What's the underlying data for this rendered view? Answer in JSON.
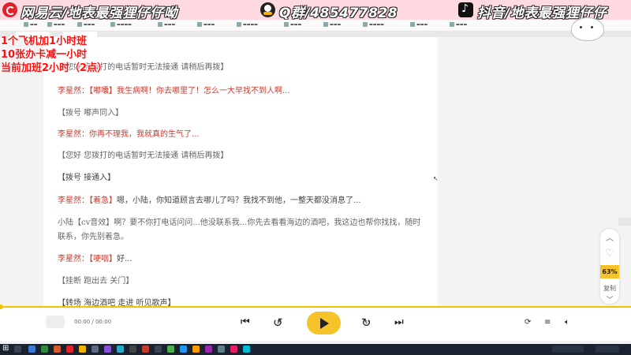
{
  "banner": {
    "netease_text": "网易云/地表最强狸仔仔呦",
    "qq_text": "Q群/485477828",
    "douyin_text": "抖音/地表最强狸仔仔"
  },
  "overlay": {
    "line1": "1个飞机加1小时班",
    "line2": "10张办卡减一小时",
    "line3": "当前加班2小时（2点）"
  },
  "reader": {
    "lines": [
      {
        "style": "gray",
        "text": "【您好  您拨打的电话暂时无法接通 请稍后再拨】"
      },
      {
        "style": "mixed",
        "speaker": "李星然：",
        "tag": "【嘟囔】",
        "body": "我生病啊！你去哪里了！怎么一大早找不到人啊..."
      },
      {
        "style": "gray",
        "text": "【拨号 嘟声同入】"
      },
      {
        "style": "red",
        "text": "李星然：你再不理我，我就真的生气了..."
      },
      {
        "style": "gray",
        "text": "【您好 您拨打的电话暂时无法接通 请稍后再拨】"
      },
      {
        "style": "dark",
        "text": "【拨号 接通入】"
      },
      {
        "style": "mixed",
        "speaker": "李星然：",
        "tag": "【着急】",
        "body": "嗯，小陆，你知道顾言去哪儿了吗？我找不到他，一整天都没消息了..."
      },
      {
        "style": "gray",
        "text": "小陆【cv音效】啊？要不你打电话问问...他没联系我...你先去看看海边的酒吧，我这边也帮你找找，随时"
      },
      {
        "style": "gray",
        "text": "联系，你先别着急。"
      },
      {
        "style": "mixed",
        "speaker": "李星然：",
        "tag": "【哽咽】",
        "body": "好..."
      },
      {
        "style": "gray",
        "text": "【挂断    跑出去 关门】"
      },
      {
        "style": "dark",
        "text": "【转场 海边酒吧 走进 听见歌声】"
      }
    ]
  },
  "tools": {
    "progress": "63%",
    "copy": "复制"
  },
  "player": {
    "time": "00:00 / 00:00",
    "skip_seconds": "15"
  },
  "colors": {
    "accent": "#f6c32a",
    "dialogue_red": "#c83a2e",
    "overlay_red": "#ff1010"
  },
  "icons": [
    "netease-logo",
    "qq-logo",
    "douyin-logo",
    "prev-track-icon",
    "rewind-15-icon",
    "play-icon",
    "forward-15-icon",
    "next-track-icon",
    "loop-icon",
    "playlist-icon",
    "volume-icon",
    "heart-icon",
    "chevron-up-icon",
    "chevron-down-icon"
  ]
}
